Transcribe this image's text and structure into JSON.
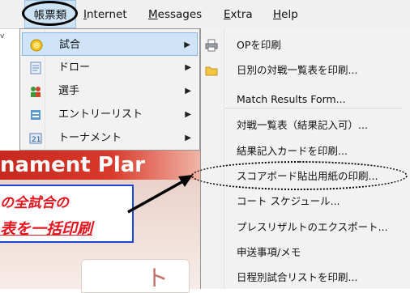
{
  "menubar": {
    "items": [
      {
        "label": "帳票類",
        "active": true
      },
      {
        "label": "Internet",
        "underline": "I",
        "rest": "nternet"
      },
      {
        "label": "Messages",
        "underline": "M",
        "rest": "essages"
      },
      {
        "label": "Extra",
        "underline": "E",
        "rest": "xtra"
      },
      {
        "label": "Help",
        "underline": "H",
        "rest": "elp"
      }
    ]
  },
  "menu1": {
    "items": [
      {
        "label": "試合",
        "icon": "coin-icon",
        "submenu": true,
        "selected": true
      },
      {
        "label": "ドロー",
        "icon": "document-icon",
        "submenu": true
      },
      {
        "label": "選手",
        "icon": "players-icon",
        "submenu": true
      },
      {
        "label": "エントリーリスト",
        "icon": "list-icon",
        "submenu": true
      },
      {
        "label": "トーナメント",
        "icon": "tournament-icon",
        "submenu": true
      }
    ]
  },
  "menu2": {
    "items": [
      {
        "label": "OPを印刷",
        "icon": "printer-icon"
      },
      {
        "label": "日別の対戦一覧表を印刷...",
        "icon": "folder-icon"
      },
      {
        "label": "Match Results Form..."
      },
      {
        "label": "対戦一覧表（結果記入可）..."
      },
      {
        "label": "結果記入カードを印刷..."
      },
      {
        "label": "スコアボード貼出用紙の印刷...",
        "highlighted": true
      },
      {
        "label": "コート スケジュール..."
      },
      {
        "label": "プレスリザルトのエクスポート..."
      },
      {
        "label": "申送事項/メモ"
      },
      {
        "label": "日程別試合リストを印刷..."
      }
    ]
  },
  "background": {
    "banner_text": "nament Plar",
    "card_text": "ト",
    "stub_text": "v"
  },
  "annotation": {
    "line1": "の全試合の",
    "line2": "表を一括印刷",
    "color": "#e8141e",
    "border_color": "#1a46d8"
  }
}
